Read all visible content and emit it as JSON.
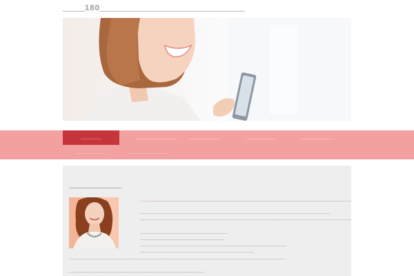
{
  "site": {
    "title": "＿＿＿180＿＿＿＿＿＿＿＿＿＿＿＿＿＿＿＿＿＿＿＿"
  },
  "nav": {
    "items": [
      {
        "label": "＿＿＿＿＿",
        "active": true
      },
      {
        "label": "＿＿＿＿＿＿＿＿＿＿",
        "active": false
      },
      {
        "label": "＿＿＿＿＿＿＿＿",
        "active": false
      },
      {
        "label": "＿＿＿＿＿＿＿",
        "active": false
      },
      {
        "label": "＿＿＿＿＿＿＿＿",
        "active": false
      },
      {
        "label": "＿＿＿＿＿＿＿",
        "active": false
      },
      {
        "label": "＿＿＿＿＿＿＿＿＿",
        "active": false
      }
    ]
  },
  "main": {
    "heading": "＿＿＿＿＿＿＿＿＿",
    "intro_link": "＿＿＿",
    "intro_rest": "＿＿＿＿＿＿＿＿＿＿＿＿＿＿＿＿＿＿＿＿＿＿＿＿＿＿＿＿＿＿＿＿＿＿＿＿＿＿＿＿＿＿＿＿＿＿＿＿＿＿＿＿＿＿＿＿＿＿＿＿＿＿＿",
    "para2_line1": "＿＿＿＿＿＿＿＿＿＿＿＿＿＿＿＿＿＿＿＿＿＿＿＿＿＿＿＿＿＿＿＿＿＿＿＿＿＿＿＿＿＿＿＿＿＿＿＿＿＿＿＿",
    "para2_line2": "＿＿＿＿＿＿＿＿＿＿＿＿＿＿＿＿＿＿＿＿＿＿＿＿＿＿＿＿＿＿＿＿＿＿＿＿＿＿＿＿＿＿＿＿＿＿＿＿＿＿＿＿＿＿＿＿＿＿＿＿＿＿＿＿＿＿＿＿＿＿＿＿",
    "list": [
      "＿＿＿＿＿＿＿＿＿＿＿＿＿＿＿＿＿＿＿＿＿＿＿＿",
      "＿＿＿＿＿＿＿＿＿＿＿＿＿＿＿＿＿＿＿＿＿＿＿",
      "＿＿＿＿＿＿＿＿＿＿＿＿＿＿＿＿＿＿＿＿＿＿＿＿＿＿＿＿＿＿＿＿＿＿＿＿＿＿＿＿",
      "＿＿＿＿＿＿＿＿＿＿＿＿＿＿＿＿＿＿＿＿＿＿＿＿＿＿＿＿＿＿＿"
    ],
    "para3": "＿＿＿＿＿＿＿＿＿＿＿＿＿＿＿＿＿＿＿＿＿＿＿＿＿＿＿＿＿＿＿＿＿＿＿＿＿＿＿＿＿＿＿＿＿＿＿＿＿＿＿＿＿＿＿＿＿＿＿",
    "para4": "＿＿＿＿＿＿＿＿＿＿＿＿＿＿＿＿＿＿＿＿＿＿＿＿＿＿＿＿＿＿＿＿＿＿＿＿＿"
  },
  "colors": {
    "nav_bg": "#f3a1a0",
    "nav_active": "#c7353c",
    "content_bg": "#eeeeee",
    "link": "#d9433f"
  }
}
